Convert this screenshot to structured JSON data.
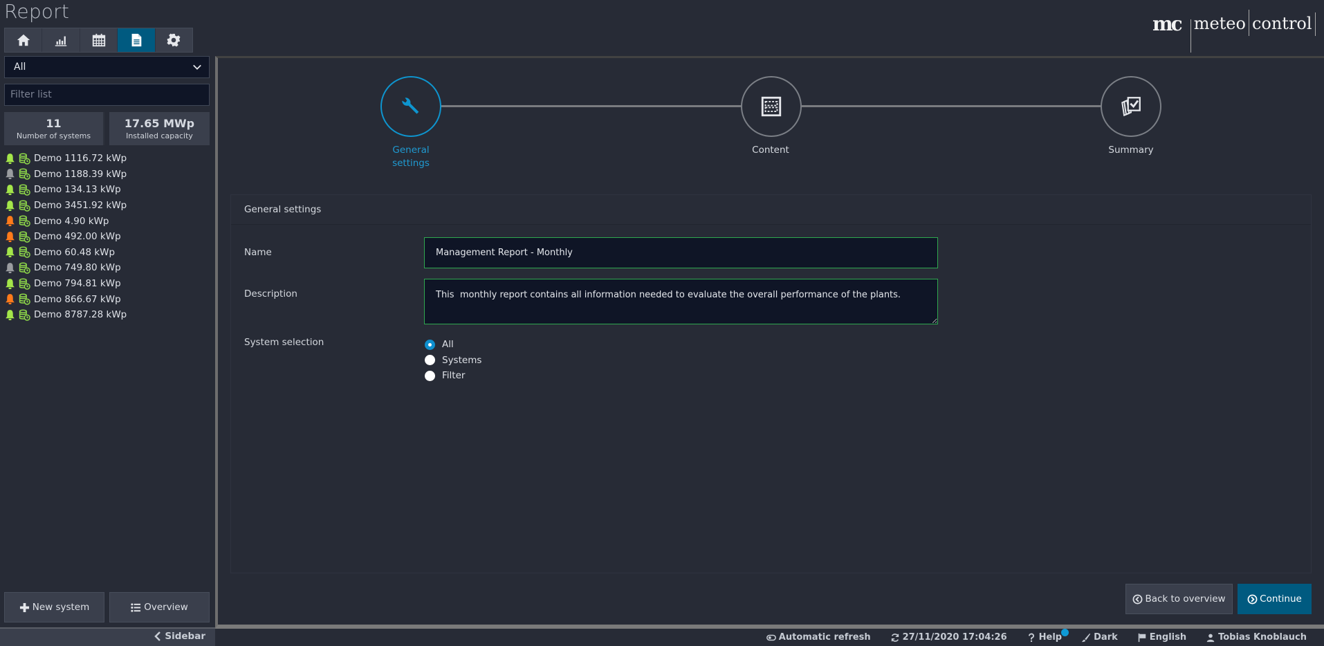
{
  "app": {
    "title": "Report"
  },
  "logo": {
    "mark": "mc",
    "word1": "meteo",
    "word2": "control"
  },
  "nav": {
    "tabs": [
      {
        "icon": "home-icon",
        "active": false
      },
      {
        "icon": "bar-chart-icon",
        "active": false
      },
      {
        "icon": "calendar-icon",
        "active": false
      },
      {
        "icon": "document-icon",
        "active": true
      },
      {
        "icon": "gear-icon",
        "active": false
      }
    ]
  },
  "sidebar": {
    "dropdown_value": "All",
    "filter_placeholder": "Filter list",
    "filter_value": "",
    "stats": {
      "systems_value": "11",
      "systems_label": "Number of systems",
      "capacity_value": "17.65 MWp",
      "capacity_label": "Installed capacity"
    },
    "systems": [
      {
        "name": "Demo 1116.72 kWp",
        "alarm": "green"
      },
      {
        "name": "Demo 1188.39 kWp",
        "alarm": "grey"
      },
      {
        "name": "Demo 134.13 kWp",
        "alarm": "green"
      },
      {
        "name": "Demo 3451.92 kWp",
        "alarm": "green"
      },
      {
        "name": "Demo 4.90 kWp",
        "alarm": "orange"
      },
      {
        "name": "Demo 492.00 kWp",
        "alarm": "orange"
      },
      {
        "name": "Demo 60.48 kWp",
        "alarm": "green"
      },
      {
        "name": "Demo 749.80 kWp",
        "alarm": "grey"
      },
      {
        "name": "Demo 794.81 kWp",
        "alarm": "green"
      },
      {
        "name": "Demo 866.67 kWp",
        "alarm": "orange"
      },
      {
        "name": "Demo 8787.28 kWp",
        "alarm": "green"
      }
    ],
    "new_system_label": "New system",
    "overview_label": "Overview",
    "toggle_label": "Sidebar"
  },
  "colors": {
    "alarm_green": "#a4e64a",
    "alarm_grey": "#9a9ca0",
    "alarm_orange": "#ff7a1a",
    "db_green": "#8fd94a",
    "accent": "#0e95cf",
    "primary_button": "#005a80",
    "input_border": "#2fa84f"
  },
  "wizard": {
    "steps": [
      {
        "label_line1": "General",
        "label_line2": "settings",
        "icon": "wrench-icon",
        "active": true
      },
      {
        "label_line1": "Content",
        "label_line2": "",
        "icon": "layout-icon",
        "active": false
      },
      {
        "label_line1": "Summary",
        "label_line2": "",
        "icon": "checklist-icon",
        "active": false
      }
    ]
  },
  "form": {
    "section_title": "General settings",
    "name_label": "Name",
    "name_value": "Management Report - Monthly",
    "description_label": "Description",
    "description_value": "This  monthly report contains all information needed to evaluate the overall performance of the plants.",
    "system_selection_label": "System selection",
    "system_selection_options": [
      {
        "label": "All",
        "checked": true
      },
      {
        "label": "Systems",
        "checked": false
      },
      {
        "label": "Filter",
        "checked": false
      }
    ],
    "back_label": "Back to overview",
    "continue_label": "Continue"
  },
  "status_bar": {
    "auto_refresh": "Automatic refresh",
    "timestamp": "27/11/2020 17:04:26",
    "help": "Help",
    "theme": "Dark",
    "language": "English",
    "user": "Tobias Knoblauch"
  }
}
